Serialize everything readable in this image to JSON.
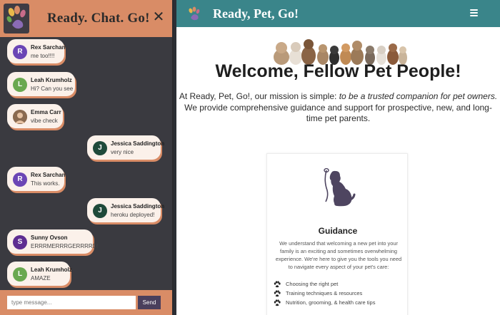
{
  "chat": {
    "title": "Ready. Chat. Go!",
    "close_icon": "close-icon",
    "messages": [
      {
        "name": "Rex Sarchan",
        "text": "me too!!!!",
        "initial": "R",
        "avatar_color": "#6b45b5",
        "side": "left"
      },
      {
        "name": "Leah Krumholz",
        "text": "Hi? Can you see",
        "initial": "L",
        "avatar_color": "#6aa84f",
        "side": "left"
      },
      {
        "name": "Emma Carr",
        "text": "vibe check",
        "initial": "",
        "avatar_color": "#a07a5a",
        "side": "left"
      },
      {
        "name": "Jessica Saddington",
        "text": "very nice",
        "initial": "J",
        "avatar_color": "#1f4a3a",
        "side": "right"
      },
      {
        "name": "Rex Sarchan",
        "text": "This works.",
        "initial": "R",
        "avatar_color": "#6b45b5",
        "side": "left"
      },
      {
        "name": "Jessica Saddington",
        "text": "heroku deployed!",
        "initial": "J",
        "avatar_color": "#1f4a3a",
        "side": "right"
      },
      {
        "name": "Sunny Ovson",
        "text": "ERRRMERRRGERRRRD!",
        "initial": "S",
        "avatar_color": "#5e2d91",
        "side": "left"
      },
      {
        "name": "Leah Krumholz",
        "text": "AMAZE",
        "initial": "L",
        "avatar_color": "#6aa84f",
        "side": "left"
      }
    ],
    "input_placeholder": "type message...",
    "send_label": "Send"
  },
  "site": {
    "brand": "Ready, Pet, Go!",
    "menu_icon": "hamburger-menu-icon",
    "welcome": "Welcome, Fellow Pet People!",
    "mission_prefix": "At Ready, Pet, Go!, our mission is simple: ",
    "mission_emphasis": "to be a trusted companion for pet owners.",
    "mission_second": "We provide comprehensive guidance and support for prospective, new, and long-time pet parents.",
    "card": {
      "title": "Guidance",
      "text": "We understand that welcoming a new pet into your family is an exciting and sometimes overwhelming experience. We're here to give you the tools you need to navigate every aspect of your pet's care:",
      "items": [
        "Choosing the right pet",
        "Training techniques & resources",
        "Nutrition, grooming, & health care tips"
      ]
    }
  },
  "colors": {
    "chat_accent": "#d98c66",
    "chat_background": "#3a3a40",
    "navbar": "#3a858a",
    "send_button": "#4a3f5c",
    "dog_silhouette": "#4e4560"
  }
}
